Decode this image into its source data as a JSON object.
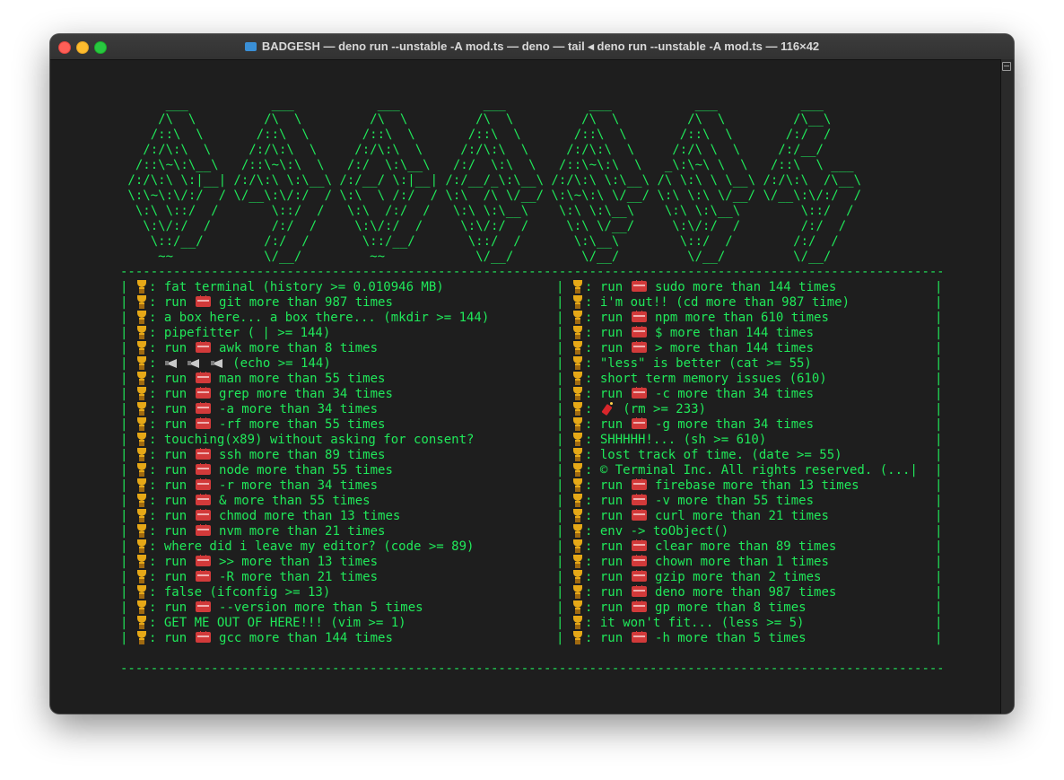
{
  "window": {
    "title": "BADGESH — deno run --unstable -A mod.ts — deno — tail ◂ deno run --unstable -A mod.ts — 116×42"
  },
  "banner": [
    "      ___           ___           ___           ___           ___           ___           ___     ",
    "     /\\  \\         /\\  \\         /\\  \\         /\\  \\         /\\  \\         /\\  \\         /\\__\\    ",
    "    /::\\  \\       /::\\  \\       /::\\  \\       /::\\  \\       /::\\  \\       /::\\  \\       /:/  /    ",
    "   /:/\\:\\  \\     /:/\\:\\  \\     /:/\\:\\  \\     /:/\\:\\  \\     /:/\\:\\  \\     /:/\\ \\  \\     /:/__/     ",
    "  /::\\~\\:\\__\\   /::\\~\\:\\  \\   /:/  \\:\\__\\   /:/  \\:\\  \\   /::\\~\\:\\  \\   _\\:\\~\\ \\  \\   /::\\  \\ ___ ",
    " /:/\\:\\ \\:|__| /:/\\:\\ \\:\\__\\ /:/__/ \\:|__| /:/__/_\\:\\__\\ /:/\\:\\ \\:\\__\\ /\\ \\:\\ \\ \\__\\ /:/\\:\\  /\\__\\",
    " \\:\\~\\:\\/:/  / \\/__\\:\\/:/  / \\:\\  \\ /:/  / \\:\\  /\\ \\/__/ \\:\\~\\:\\ \\/__/ \\:\\ \\:\\ \\/__/ \\/__\\:\\/:/  /",
    "  \\:\\ \\::/  /       \\::/  /   \\:\\  /:/  /   \\:\\ \\:\\__\\    \\:\\ \\:\\__\\    \\:\\ \\:\\__\\        \\::/  / ",
    "   \\:\\/:/  /        /:/  /     \\:\\/:/  /     \\:\\/:/  /     \\:\\ \\/__/     \\:\\/:/  /        /:/  /  ",
    "    \\::/__/        /:/  /       \\::/__/       \\::/  /       \\:\\__\\        \\::/  /        /:/  /   ",
    "     ~~            \\/__/         ~~            \\/__/         \\/__/         \\/__/         \\/__/    "
  ],
  "divider": "---------------------------------------------------------------------------------------------------------------------",
  "separator": "|",
  "left_col": [
    {
      "icon": "",
      "text": "fat terminal (history >= 0.010946 MB)"
    },
    {
      "icon": "toolbox",
      "pre": "run ",
      "text": "git more than 987 times"
    },
    {
      "icon": "",
      "text": "a box here... a box there... (mkdir >= 144)"
    },
    {
      "icon": "",
      "text": "pipefitter ( | >= 144)"
    },
    {
      "icon": "toolbox",
      "pre": "run ",
      "text": "awk more than 8 times"
    },
    {
      "icon": "horns",
      "text": "(echo >= 144)"
    },
    {
      "icon": "toolbox",
      "pre": "run ",
      "text": "man more than 55 times"
    },
    {
      "icon": "toolbox",
      "pre": "run ",
      "text": "grep more than 34 times"
    },
    {
      "icon": "toolbox",
      "pre": "run ",
      "text": "-a more than 34 times"
    },
    {
      "icon": "toolbox",
      "pre": "run ",
      "text": "-rf more than 55 times"
    },
    {
      "icon": "",
      "text": "touching(x89) without asking for consent?"
    },
    {
      "icon": "toolbox",
      "pre": "run ",
      "text": "ssh more than 89 times"
    },
    {
      "icon": "toolbox",
      "pre": "run ",
      "text": "node more than 55 times"
    },
    {
      "icon": "toolbox",
      "pre": "run ",
      "text": "-r more than 34 times"
    },
    {
      "icon": "toolbox",
      "pre": "run ",
      "text": "& more than 55 times"
    },
    {
      "icon": "toolbox",
      "pre": "run ",
      "text": "chmod more than 13 times"
    },
    {
      "icon": "toolbox",
      "pre": "run ",
      "text": "nvm more than 21 times"
    },
    {
      "icon": "",
      "text": "where did i leave my editor? (code >= 89)"
    },
    {
      "icon": "toolbox",
      "pre": "run ",
      "text": ">> more than 13 times"
    },
    {
      "icon": "toolbox",
      "pre": "run ",
      "text": "-R more than 21 times"
    },
    {
      "icon": "",
      "text": "false (ifconfig >= 13)"
    },
    {
      "icon": "toolbox",
      "pre": "run ",
      "text": "--version more than 5 times"
    },
    {
      "icon": "",
      "text": "GET ME OUT OF HERE!!! (vim >= 1)"
    },
    {
      "icon": "toolbox",
      "pre": "run ",
      "text": "gcc more than 144 times"
    }
  ],
  "right_col": [
    {
      "icon": "toolbox",
      "pre": "run ",
      "text": "sudo more than 144 times"
    },
    {
      "icon": "",
      "text": "i'm out!! (cd more than 987 time)"
    },
    {
      "icon": "toolbox",
      "pre": "run ",
      "text": "npm more than 610 times"
    },
    {
      "icon": "toolbox",
      "pre": "run ",
      "text": "$ more than 144 times"
    },
    {
      "icon": "toolbox",
      "pre": "run ",
      "text": "> more than 144 times"
    },
    {
      "icon": "",
      "text": "\"less\" is better (cat >= 55)"
    },
    {
      "icon": "",
      "text": "short term memory issues (610)"
    },
    {
      "icon": "toolbox",
      "pre": "run ",
      "text": "-c more than 34 times"
    },
    {
      "icon": "firecracker",
      "text": "(rm >= 233)"
    },
    {
      "icon": "toolbox",
      "pre": "run ",
      "text": "-g more than 34 times"
    },
    {
      "icon": "",
      "text": "SHHHHH!... (sh >= 610)"
    },
    {
      "icon": "",
      "text": "lost track of time. (date >= 55)"
    },
    {
      "icon": "",
      "text": "© Terminal Inc. All rights reserved. (...|"
    },
    {
      "icon": "toolbox",
      "pre": "run ",
      "text": "firebase more than 13 times"
    },
    {
      "icon": "toolbox",
      "pre": "run ",
      "text": "-v more than 55 times"
    },
    {
      "icon": "toolbox",
      "pre": "run ",
      "text": "curl more than 21 times"
    },
    {
      "icon": "",
      "text": "env -> toObject()"
    },
    {
      "icon": "toolbox",
      "pre": "run ",
      "text": "clear more than 89 times"
    },
    {
      "icon": "toolbox",
      "pre": "run ",
      "text": "chown more than 1 times"
    },
    {
      "icon": "toolbox",
      "pre": "run ",
      "text": "gzip more than 2 times"
    },
    {
      "icon": "toolbox",
      "pre": "run ",
      "text": "deno more than 987 times"
    },
    {
      "icon": "toolbox",
      "pre": "run ",
      "text": "gp more than 8 times"
    },
    {
      "icon": "",
      "text": "it won't fit... (less >= 5)"
    },
    {
      "icon": "toolbox",
      "pre": "run ",
      "text": "-h more than 5 times"
    }
  ]
}
